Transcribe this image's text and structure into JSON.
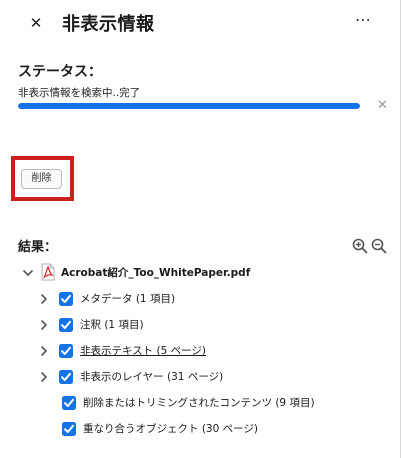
{
  "header": {
    "title": "非表示情報",
    "close_glyph": "✕",
    "more_glyph": "⋯"
  },
  "status": {
    "label": "ステータス：",
    "text": "非表示情報を検索中..完了",
    "progress_fraction": 1.0,
    "cancel_glyph": "✕"
  },
  "actions": {
    "delete_label": "削除"
  },
  "results": {
    "label": "結果：",
    "file_name": "Acrobat紹介_Too_WhitePaper.pdf",
    "items": [
      {
        "label": "メタデータ (1 項目)",
        "expandable": true,
        "checked": true,
        "link": false
      },
      {
        "label": "注釈 (1 項目)",
        "expandable": true,
        "checked": true,
        "link": false
      },
      {
        "label": "非表示テキスト (5 ページ)",
        "expandable": true,
        "checked": true,
        "link": true
      },
      {
        "label": "非表示のレイヤー (31 ページ)",
        "expandable": true,
        "checked": true,
        "link": false
      },
      {
        "label": "削除またはトリミングされたコンテンツ (9 項目)",
        "expandable": false,
        "checked": true,
        "link": false
      },
      {
        "label": "重なり合うオブジェクト (30 ページ)",
        "expandable": false,
        "checked": true,
        "link": false
      }
    ]
  },
  "colors": {
    "accent": "#1473e6",
    "highlight": "#cc1f1f",
    "checkbox": "#1473e6",
    "pdf_red": "#d7282f"
  },
  "icons": {
    "close": "close-icon",
    "more": "more-options-icon",
    "zoom_in": "zoom-in-icon",
    "zoom_out": "zoom-out-icon",
    "chevron_down": "chevron-down-icon",
    "chevron_right": "chevron-right-icon",
    "pdf": "pdf-file-icon",
    "checkbox": "checkbox-checked-icon"
  }
}
